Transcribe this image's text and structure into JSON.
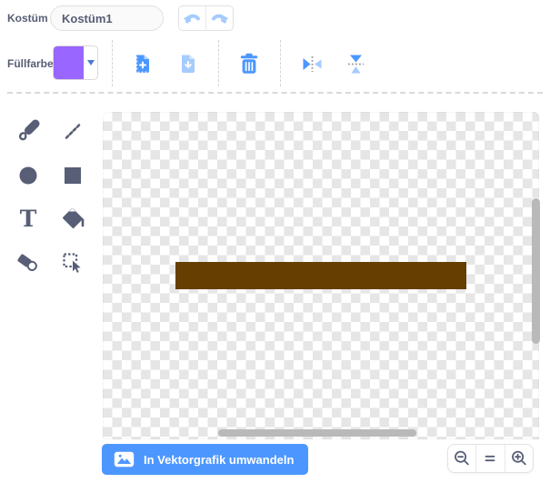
{
  "colors": {
    "accent": "#4C97FF",
    "accent_disabled": "#A6CBFF",
    "fill_purple": "#9966FF",
    "shape_brown": "#663E02",
    "icon_gray": "#575E75",
    "scrollbar_gray": "#b9b9b9"
  },
  "header": {
    "costume_label": "Kostüm",
    "costume_name": "Kostüm1",
    "undo_icon": "undo-icon",
    "redo_icon": "redo-icon"
  },
  "fill_picker": {
    "label": "Füllfarbe",
    "selected_color": "#9966FF"
  },
  "toolbar_icons": [
    "copy-icon",
    "paste-icon",
    "trash-icon",
    "flip-horizontal-icon",
    "flip-vertical-icon"
  ],
  "tools": [
    "brush",
    "line",
    "circle",
    "rectangle",
    "text",
    "fill",
    "eraser",
    "select"
  ],
  "canvas": {
    "shape": {
      "type": "rectangle",
      "color": "#663E02"
    }
  },
  "footer": {
    "convert_label": "In Vektorgrafik umwandeln",
    "zoom_controls": [
      "zoom-out",
      "zoom-reset",
      "zoom-in"
    ]
  }
}
